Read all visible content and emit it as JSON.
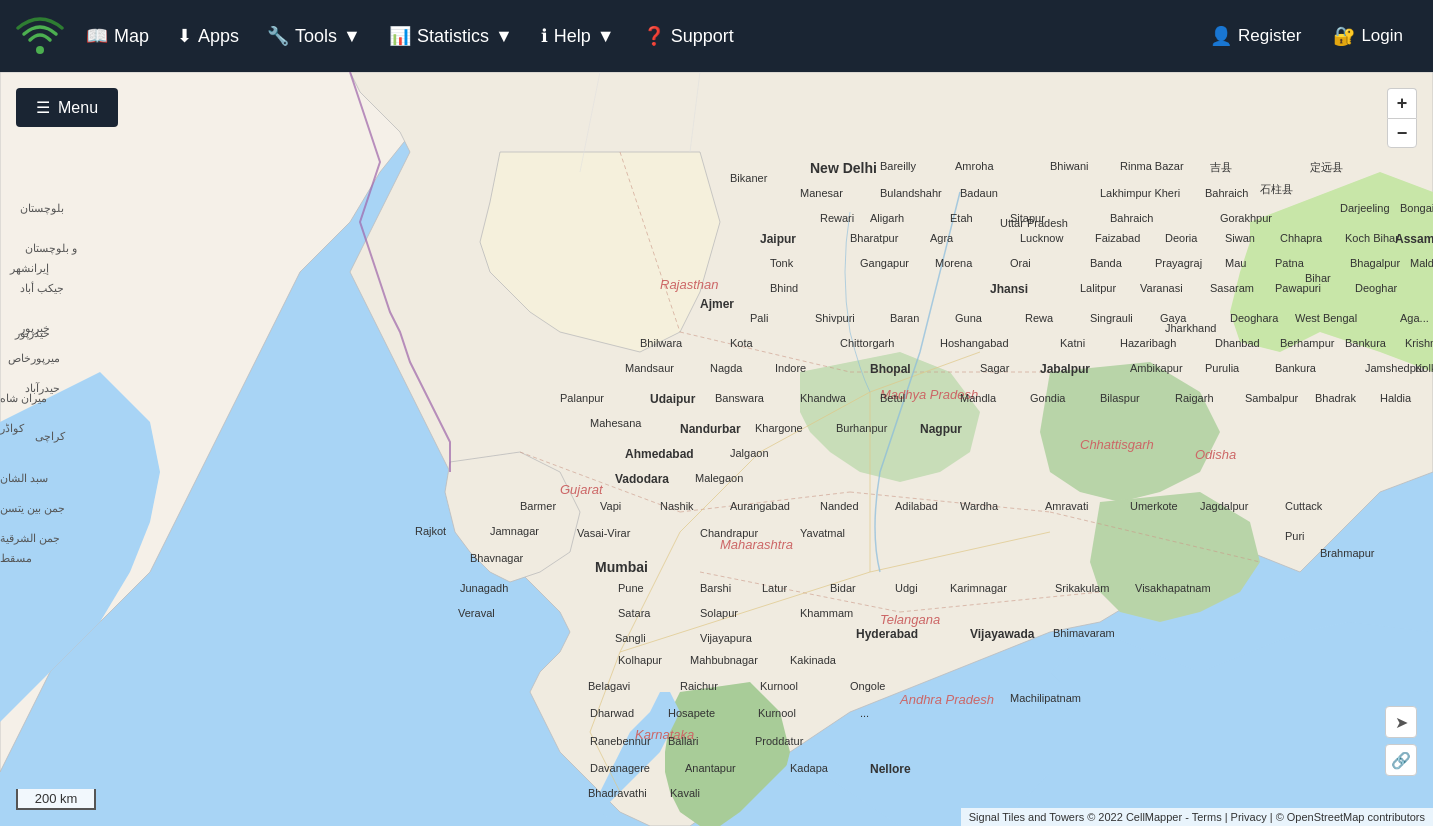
{
  "navbar": {
    "logo_alt": "CellMapper Logo",
    "items": [
      {
        "id": "map",
        "label": "Map",
        "icon": "📖",
        "has_dropdown": false
      },
      {
        "id": "apps",
        "label": "Apps",
        "icon": "⬇",
        "has_dropdown": false
      },
      {
        "id": "tools",
        "label": "Tools",
        "icon": "🔧",
        "has_dropdown": true
      },
      {
        "id": "statistics",
        "label": "Statistics",
        "icon": "📊",
        "has_dropdown": true
      },
      {
        "id": "help",
        "label": "Help",
        "icon": "ℹ",
        "has_dropdown": true
      },
      {
        "id": "support",
        "label": "Support",
        "icon": "❓",
        "has_dropdown": false
      }
    ],
    "right_items": [
      {
        "id": "register",
        "label": "Register",
        "icon": "👤"
      },
      {
        "id": "login",
        "label": "Login",
        "icon": "🔐"
      }
    ]
  },
  "sidebar": {
    "menu_label": "Menu"
  },
  "map": {
    "zoom_in": "+",
    "zoom_out": "−",
    "scale_value": "200 km",
    "attribution": "Signal Tiles and Towers © 2022 CellMapper - Terms | Privacy | © OpenStreetMap contributors"
  },
  "colors": {
    "navbar_bg": "#1a2533",
    "nav_text": "#ffffff",
    "map_water": "#a8d4f5",
    "map_land": "#f5f0e8",
    "map_green": "#c8e6c9",
    "map_border": "#9e9e9e"
  }
}
